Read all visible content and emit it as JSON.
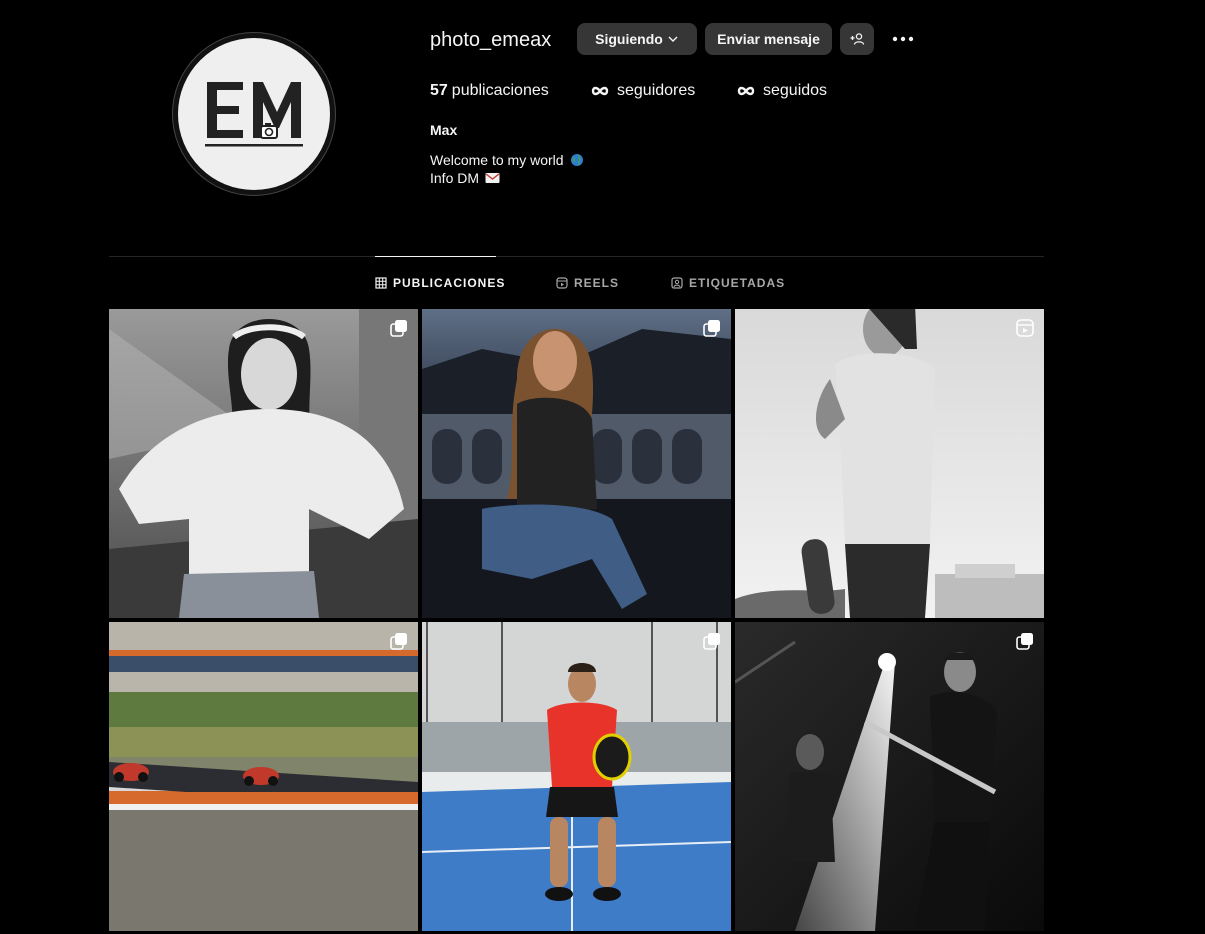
{
  "profile": {
    "username": "photo_emeax",
    "avatar_logo_text": "EM",
    "follow_button": "Siguiendo",
    "message_button": "Enviar mensaje",
    "stats": {
      "posts_count": "57",
      "posts_label": "publicaciones",
      "followers_label": "seguidores",
      "following_label": "seguidos"
    },
    "name": "Max",
    "bio_line1": "Welcome to my world",
    "bio_line2": "Info DM"
  },
  "tabs": [
    {
      "label": "PUBLICACIONES",
      "active": true
    },
    {
      "label": "REELS",
      "active": false
    },
    {
      "label": "ETIQUETADAS",
      "active": false
    }
  ],
  "posts": [
    {
      "subject": "woman in white polo, black and white portrait",
      "badge": "multi-post-icon"
    },
    {
      "subject": "woman seated on terrace at dusk",
      "badge": "multi-post-icon"
    },
    {
      "subject": "man with skateboard, black and white",
      "badge": "reel-icon"
    },
    {
      "subject": "motorcycles on race track",
      "badge": "multi-post-icon"
    },
    {
      "subject": "padel player on blue court",
      "badge": "multi-post-icon"
    },
    {
      "subject": "guitarist on stage, black and white",
      "badge": "multi-post-icon"
    }
  ],
  "colors": {
    "background": "#000000",
    "button": "#363636",
    "text": "#f5f5f5",
    "muted": "#a8a8a8",
    "divider": "#262626"
  }
}
